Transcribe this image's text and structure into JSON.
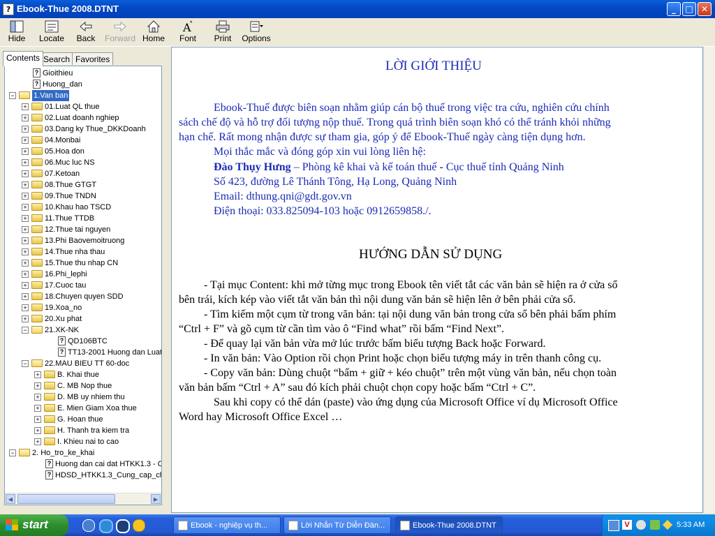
{
  "window": {
    "title": "Ebook-Thue 2008.DTNT"
  },
  "toolbar": [
    {
      "id": "hide",
      "label": "Hide",
      "enabled": true
    },
    {
      "id": "locate",
      "label": "Locate",
      "enabled": true
    },
    {
      "id": "back",
      "label": "Back",
      "enabled": true
    },
    {
      "id": "forward",
      "label": "Forward",
      "enabled": false
    },
    {
      "id": "home",
      "label": "Home",
      "enabled": true
    },
    {
      "id": "font",
      "label": "Font",
      "enabled": true
    },
    {
      "id": "print",
      "label": "Print",
      "enabled": true
    },
    {
      "id": "options",
      "label": "Options",
      "enabled": true
    }
  ],
  "tabs": [
    "Contents",
    "Search",
    "Favorites"
  ],
  "tree": [
    {
      "label": "Gioithieu",
      "type": "doc",
      "level": 1
    },
    {
      "label": "Huong_dan",
      "type": "doc",
      "level": 1
    },
    {
      "label": "1.Van ban",
      "type": "folder-open",
      "level": 0,
      "selected": true
    },
    {
      "label": "01.Luat QL thue",
      "type": "folder",
      "level": 1
    },
    {
      "label": "02.Luat doanh nghiep",
      "type": "folder",
      "level": 1
    },
    {
      "label": "03.Dang ky Thue_DKKDoanh",
      "type": "folder",
      "level": 1
    },
    {
      "label": "04.Monbai",
      "type": "folder",
      "level": 1
    },
    {
      "label": "05.Hoa don",
      "type": "folder",
      "level": 1
    },
    {
      "label": "06.Muc luc NS",
      "type": "folder",
      "level": 1
    },
    {
      "label": "07.Ketoan",
      "type": "folder",
      "level": 1
    },
    {
      "label": "08.Thue GTGT",
      "type": "folder",
      "level": 1
    },
    {
      "label": "09.Thue TNDN",
      "type": "folder",
      "level": 1
    },
    {
      "label": "10.Khau hao TSCD",
      "type": "folder",
      "level": 1
    },
    {
      "label": "11.Thue TTDB",
      "type": "folder",
      "level": 1
    },
    {
      "label": "12.Thue tai nguyen",
      "type": "folder",
      "level": 1
    },
    {
      "label": "13.Phi Baovemoitruong",
      "type": "folder",
      "level": 1
    },
    {
      "label": "14.Thue nha thau",
      "type": "folder",
      "level": 1
    },
    {
      "label": "15.Thue thu nhap CN",
      "type": "folder",
      "level": 1
    },
    {
      "label": "16.Phi_lephi",
      "type": "folder",
      "level": 1
    },
    {
      "label": "17.Cuoc tau",
      "type": "folder",
      "level": 1
    },
    {
      "label": "18.Chuyen quyen SDD",
      "type": "folder",
      "level": 1
    },
    {
      "label": "19.Xoa_no",
      "type": "folder",
      "level": 1
    },
    {
      "label": "20.Xu phat",
      "type": "folder",
      "level": 1
    },
    {
      "label": "21.XK-NK",
      "type": "folder-open",
      "level": 1
    },
    {
      "label": "QD106BTC",
      "type": "doc",
      "level": 3
    },
    {
      "label": "TT13-2001 Huong dan Luat",
      "type": "doc",
      "level": 3
    },
    {
      "label": "22.MAU BIEU TT 60-doc",
      "type": "folder-open",
      "level": 1
    },
    {
      "label": "B. Khai thue",
      "type": "folder",
      "level": 2
    },
    {
      "label": "C. MB Nop thue",
      "type": "folder",
      "level": 2
    },
    {
      "label": "D. MB uy nhiem thu",
      "type": "folder",
      "level": 2
    },
    {
      "label": "E. Mien  Giam Xoa  thue",
      "type": "folder",
      "level": 2
    },
    {
      "label": "G. Hoan thue",
      "type": "folder",
      "level": 2
    },
    {
      "label": "H. Thanh tra kiem tra",
      "type": "folder",
      "level": 2
    },
    {
      "label": "I. Khieu nai to cao",
      "type": "folder",
      "level": 2
    },
    {
      "label": "2. Ho_tro_ke_khai",
      "type": "folder-open",
      "level": 0
    },
    {
      "label": "Huong dan cai dat HTKK1.3 - Cu",
      "type": "doc",
      "level": 2
    },
    {
      "label": "HDSD_HTKK1.3_Cung_cap_ch",
      "type": "doc",
      "level": 2
    }
  ],
  "content": {
    "intro_title": "LỜI GIỚI THIỆU",
    "intro_p1": [
      "Ebook-Thuế được biên soạn nhằm giúp cán bộ thuế trong việc tra cứu, nghiên cứu chính",
      "sách chế độ và hỗ trợ đối tượng nộp thuế. Trong quá trình biên soạn khó có thể tránh khỏi những",
      "hạn chế. Rất mong nhận được sự tham gia, góp ý để Ebook-Thuế ngày càng tiện dụng hơn."
    ],
    "contact_intro": "Mọi thắc mắc và đóng góp xin vui lòng liên hệ:",
    "contact_name": "Đào Thụy Hưng",
    "contact_role": " – Phòng kê khai và kế toán thuế",
    "contact_dash": " - ",
    "contact_org": "Cục thuế tỉnh Quảng Ninh",
    "contact_address": "Số 423, đường Lê Thánh Tông, Hạ Long, Quảng Ninh",
    "contact_email": "Email: dthung.qni@gdt.gov.vn",
    "contact_phone": "Điện thoại: 033.825094-103 hoặc 0912659858./.",
    "guide_title": "HƯỚNG DẪN SỬ DỤNG",
    "guide_lines": [
      "- Tại mục Content: khi mở từng mục trong Ebook tên viết tắt các văn bản sẽ hiện ra ở cửa sổ",
      "bên trái, kích kép vào viết tắt văn bản thì nội dung văn bản sẽ hiện lên ở bên phải cửa sổ.",
      "- Tìm kiếm một cụm từ trong văn bản: tại nội dung văn bản trong cửa sổ bên phải bấm phím",
      "“Ctrl + F” và gõ cụm từ cần tìm vào ô “Find what” rồi bấm “Find Next”.",
      "- Để quay lại văn bản vừa mở lúc trước bấm biểu tượng Back hoặc Forward.",
      "- In văn bản: Vào Option rồi chọn Print hoặc chọn biểu tượng máy in trên thanh công cụ.",
      "- Copy văn bản: Dùng chuột “bấm + giữ + kéo chuột” trên một vùng văn bản, nếu chọn toàn",
      "văn bản bấm “Ctrl + A” sau đó kích phải chuột chọn copy hoặc bấm “Ctrl + C”.",
      "Sau khi copy có thể dán (paste) vào ứng dụng của Microsoft Office ví dụ Microsoft Office",
      "Word hay Microsoft Office Excel …"
    ]
  },
  "taskbar": {
    "start_label": "start",
    "tasks": [
      {
        "label": "Ebook - nghiệp vụ th...",
        "active": false
      },
      {
        "label": "Lời Nhắn Từ Diễn Đàn...",
        "active": false
      },
      {
        "label": "Ebook-Thue 2008.DTNT",
        "active": true
      }
    ],
    "clock": "5:33 AM"
  },
  "colors": {
    "content_blue": "#1A2BB5",
    "selection": "#316AC5",
    "titlebar": "#0348C6",
    "taskbar": "#245EDB"
  }
}
